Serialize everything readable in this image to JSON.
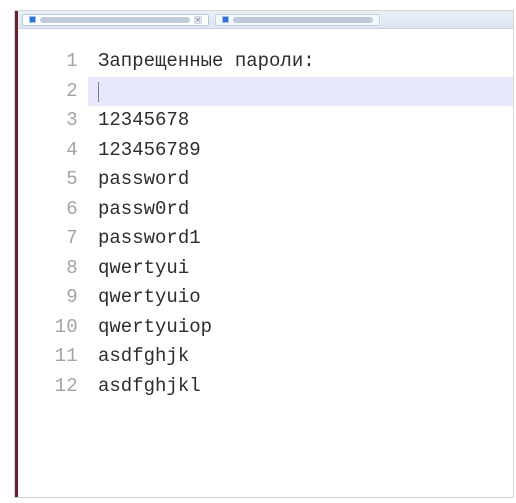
{
  "editor": {
    "tabs": [
      {
        "active": true
      },
      {
        "active": false
      }
    ],
    "lines": [
      {
        "num": "1",
        "text": "Запрещенные пароли:"
      },
      {
        "num": "2",
        "text": ""
      },
      {
        "num": "3",
        "text": "12345678"
      },
      {
        "num": "4",
        "text": "123456789"
      },
      {
        "num": "5",
        "text": "password"
      },
      {
        "num": "6",
        "text": "passw0rd"
      },
      {
        "num": "7",
        "text": "password1"
      },
      {
        "num": "8",
        "text": "qwertyui"
      },
      {
        "num": "9",
        "text": "qwertyuio"
      },
      {
        "num": "10",
        "text": "qwertyuiop"
      },
      {
        "num": "11",
        "text": "asdfghjk"
      },
      {
        "num": "12",
        "text": "asdfghjkl"
      }
    ],
    "current_line": 2
  }
}
